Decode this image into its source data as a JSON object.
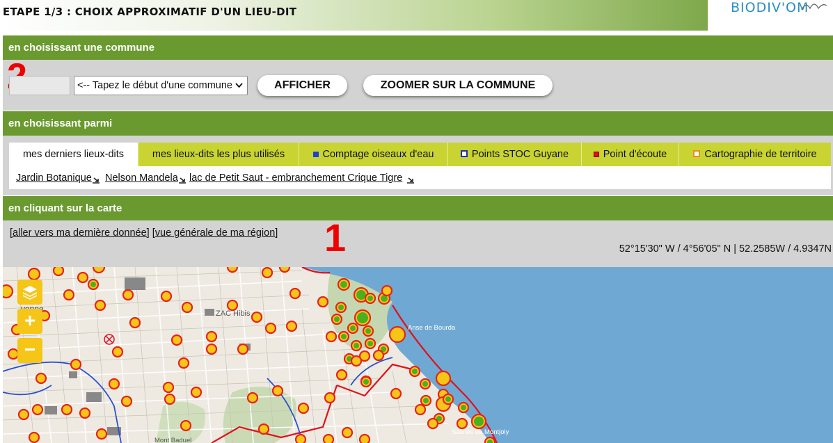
{
  "header": {
    "title": "ETAPE 1/3 : CHOIX APPROXIMATIF D'UN LIEU-DIT",
    "logo_text": "BIODIV'OM"
  },
  "section_commune": {
    "heading": "en choisissant une commune",
    "step_number": "2",
    "code_input_value": "",
    "commune_select_value": "<-- Tapez le début d'une commune",
    "show_button": "AFFICHER",
    "zoom_button": "ZOOMER SUR LA COMMUNE"
  },
  "section_parmi": {
    "heading": "en choisissant parmi",
    "tabs": [
      {
        "label": "mes derniers lieux-dits",
        "marker": "",
        "active": true
      },
      {
        "label": "mes lieux-dits les plus utilisés",
        "marker": "",
        "active": false
      },
      {
        "label": "Comptage oiseaux d'eau",
        "marker": "blue-filled-square-icon",
        "active": false
      },
      {
        "label": "Points STOC Guyane",
        "marker": "blue-outline-square-icon",
        "active": false
      },
      {
        "label": "Point d'écoute",
        "marker": "red-filled-square-icon",
        "active": false
      },
      {
        "label": "Cartographie de territoire",
        "marker": "orange-outline-square-icon",
        "active": false
      }
    ],
    "recent_places": [
      "Jardin Botanique",
      "Nelson Mandela",
      "lac de Petit Saut - embranchement Crique Tigre"
    ]
  },
  "section_carte": {
    "heading": "en cliquant sur la carte",
    "step_number": "1",
    "link_last_data": "[aller vers ma dernière donnée]",
    "link_region": "[vue générale de ma région]",
    "coordinates": "52°15'30\" W / 4°56'05\" N | 52.2585W / 4.9347N"
  },
  "map": {
    "labels": [
      "ZAC Hibis",
      "Anse de Bourda",
      "Mont Baduel",
      "Salines de Montjoly",
      "yenne"
    ],
    "controls": [
      "layers-icon",
      "zoom-in-icon",
      "zoom-out-icon"
    ]
  },
  "colors": {
    "header_green": "#6a9a2f",
    "tab_yellow": "#c9d432",
    "marker_fill": "#f5c518",
    "marker_border": "#e8221b",
    "marker_inner_green": "#4caf1e",
    "sea": "#6fa9d3",
    "step_number": "#ee0000"
  }
}
